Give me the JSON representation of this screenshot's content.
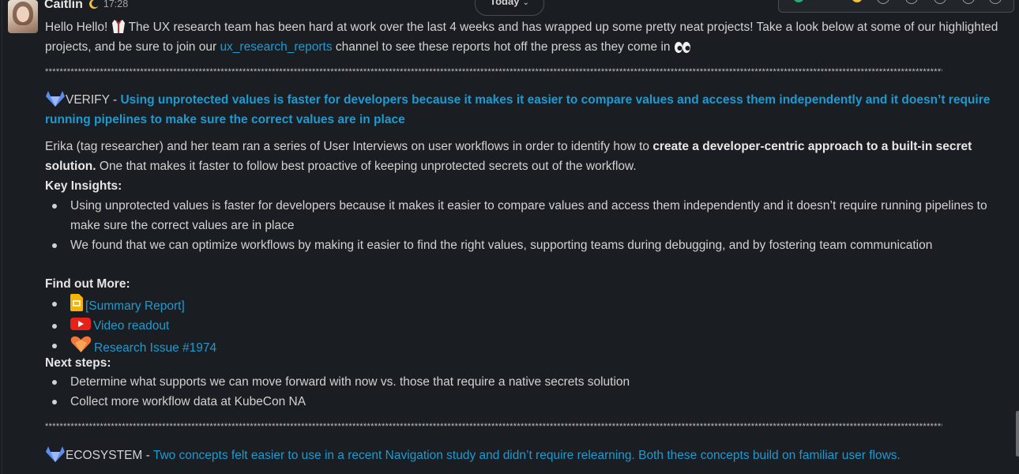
{
  "message": {
    "author": "Caitlin",
    "time": "17:28",
    "intro_part1": "Hello Hello! ",
    "intro_part2": " The UX research team has been hard at work over the last 4 weeks and has wrapped up some pretty neat projects! Take a look below at some of our highlighted projects, and be sure to join our ",
    "channel_link": "ux_research_reports",
    "intro_part3": " channel to see these reports hot off the press as they come in "
  },
  "divider": "***************************************************************************************************************************************************************************************************************************************************************",
  "date_pill": {
    "label": "Today"
  },
  "verify": {
    "label": "VERIFY - ",
    "title_link": "Using unprotected values is faster for developers because it makes it easier to compare values and access them independently and it doesn’t require running pipelines to make sure the correct values are in place",
    "body_part1": " Erika (tag researcher) and her team ran a series of User Interviews on user workflows in order to identify how to ",
    "body_bold": "create a developer-centric approach to a built-in secret solution.",
    "body_part2": " One that makes it faster to follow best proactive of keeping unprotected secrets out of the workflow.",
    "key_insights_heading": "Key Insights:",
    "insights": [
      "Using unprotected values is faster for developers because it makes it easier to compare values and access them independently and it doesn’t require running pipelines to make sure the correct values are in place",
      " We found that we can optimize workflows by making it easier to find the right values, supporting teams during debugging, and by fostering team communication"
    ],
    "find_more_heading": "Find out More:",
    "links": [
      {
        "label": "[Summary Report]",
        "icon": "google-slides-icon"
      },
      {
        "label": "Video readout",
        "icon": "youtube-icon"
      },
      {
        "label": "Research Issue #1974",
        "icon": "heart-icon"
      }
    ],
    "next_steps_heading": "Next steps:",
    "next_steps": [
      "Determine what supports we can move forward with now vs. those that require a native secrets solution",
      "Collect more workflow data at KubeCon NA"
    ]
  },
  "ecosystem": {
    "label": "ECOSYSTEM - ",
    "title_link": "Two concepts felt easier to use in a recent Navigation study and didn’t require relearning. Both these concepts build on familiar user flows."
  },
  "colors": {
    "background": "#1a1d21",
    "text": "#d1d2d3",
    "link": "#1d9bd1",
    "gitlab_orange": "#fc6d26"
  }
}
